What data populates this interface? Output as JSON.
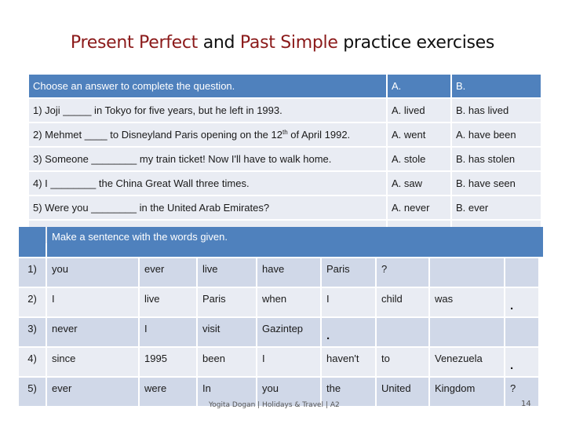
{
  "title": {
    "part1": "Present Perfect",
    "part2": " and ",
    "part3": "Past Simple",
    "part4": " practice exercises"
  },
  "colors": {
    "header_blue": "#4f81bd",
    "row_light": "#e9ecf3",
    "row_dark": "#d0d8e8",
    "title_red": "#8b1a1a"
  },
  "exercise1": {
    "header": {
      "question": "Choose an answer to complete the question.",
      "a": "A.",
      "b": "B."
    },
    "rows": [
      {
        "q": "1) Joji _____ in Tokyo for five years, but he left in 1993.",
        "a": "A.   lived",
        "b": "B.   has lived"
      },
      {
        "q_pre": "2) Mehmet ____  to Disneyland Paris opening on the 12",
        "q_sup": "th",
        "q_post": " of April 1992.",
        "a": "A.  went",
        "b": "A.  have been"
      },
      {
        "q": "3) Someone ________ my train ticket! Now I'll have to walk home.",
        "a": "A.  stole",
        "b": "B.  has stolen"
      },
      {
        "q": "4) I ________ the China Great Wall three times.",
        "a": "A.  saw",
        "b": "B.   have seen"
      },
      {
        "q": "5) Were you ________ in the United Arab Emirates?",
        "a": "A.  never",
        "b": "B.   ever"
      }
    ]
  },
  "exercise2": {
    "header": "Make a sentence with the words given.",
    "rows": [
      {
        "num": "1)",
        "words": [
          "you",
          "ever",
          "live",
          "have",
          "Paris",
          "?",
          "",
          ""
        ]
      },
      {
        "num": "2)",
        "words": [
          "I",
          "live",
          "Paris",
          "when",
          "I",
          "child",
          "was",
          "."
        ]
      },
      {
        "num": "3)",
        "words": [
          "never",
          "I",
          "visit",
          "Gazintep",
          ".",
          "",
          "",
          ""
        ]
      },
      {
        "num": "4)",
        "words": [
          "since",
          "1995",
          "been",
          "I",
          "haven't",
          "to",
          "Venezuela",
          "."
        ]
      },
      {
        "num": "5)",
        "words": [
          "ever",
          "were",
          "In",
          "you",
          "the",
          "United",
          "Kingdom",
          "?"
        ]
      }
    ]
  },
  "footer": {
    "text": "Yogita Dogan | Holidays & Travel | A2",
    "page": "14"
  }
}
